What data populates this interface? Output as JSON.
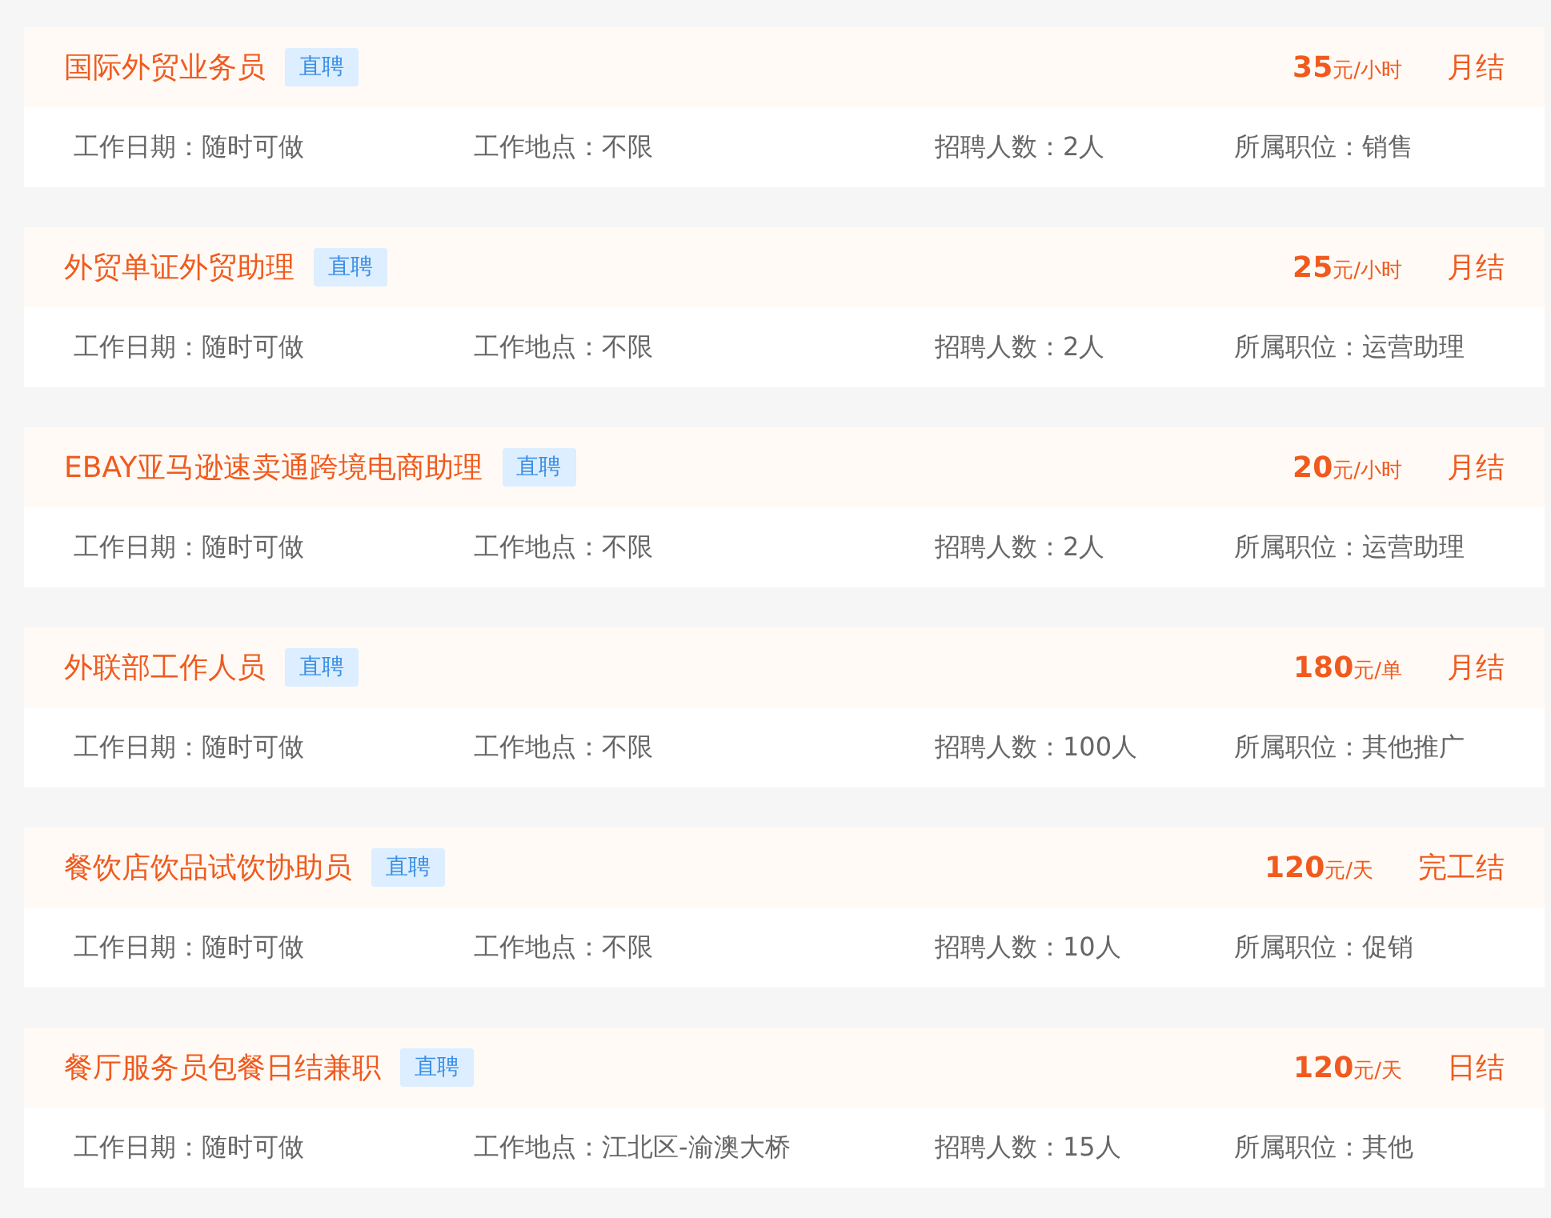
{
  "jobs": [
    {
      "title": "国际外贸业务员",
      "tag": "直聘",
      "price": "35",
      "unit": "元/小时",
      "settlement": "月结",
      "details": [
        "工作日期：随时可做",
        "工作地点：不限",
        "招聘人数：2人",
        "所属职位：销售"
      ]
    },
    {
      "title": "外贸单证外贸助理",
      "tag": "直聘",
      "price": "25",
      "unit": "元/小时",
      "settlement": "月结",
      "details": [
        "工作日期：随时可做",
        "工作地点：不限",
        "招聘人数：2人",
        "所属职位：运营助理"
      ]
    },
    {
      "title": "EBAY亚马逊速卖通跨境电商助理",
      "tag": "直聘",
      "price": "20",
      "unit": "元/小时",
      "settlement": "月结",
      "details": [
        "工作日期：随时可做",
        "工作地点：不限",
        "招聘人数：2人",
        "所属职位：运营助理"
      ]
    },
    {
      "title": "外联部工作人员",
      "tag": "直聘",
      "price": "180",
      "unit": "元/单",
      "settlement": "月结",
      "details": [
        "工作日期：随时可做",
        "工作地点：不限",
        "招聘人数：100人",
        "所属职位：其他推广"
      ]
    },
    {
      "title": "餐饮店饮品试饮协助员",
      "tag": "直聘",
      "price": "120",
      "unit": "元/天",
      "settlement": "完工结",
      "details": [
        "工作日期：随时可做",
        "工作地点：不限",
        "招聘人数：10人",
        "所属职位：促销"
      ]
    },
    {
      "title": "餐厅服务员包餐日结兼职",
      "tag": "直聘",
      "price": "120",
      "unit": "元/天",
      "settlement": "日结",
      "details": [
        "工作日期：随时可做",
        "工作地点：江北区-渝澳大桥",
        "招聘人数：15人",
        "所属职位：其他"
      ]
    }
  ]
}
